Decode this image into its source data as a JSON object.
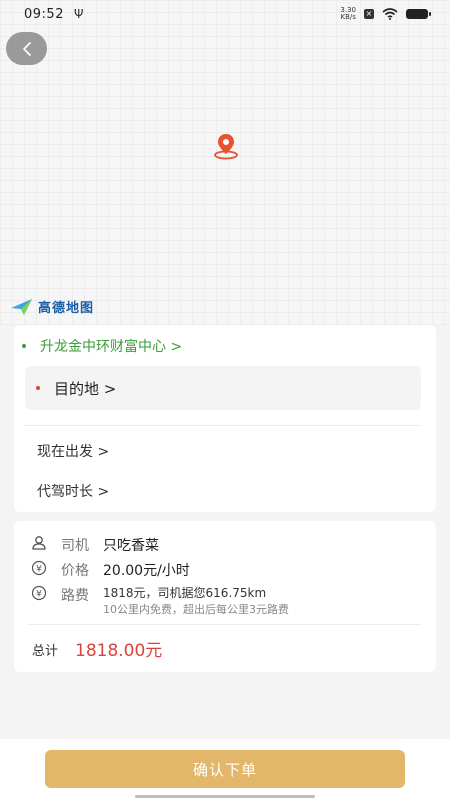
{
  "status_bar": {
    "time": "09:52",
    "net_speed_value": "3.30",
    "net_speed_unit": "KB/s"
  },
  "map": {
    "provider_label": "高德地图",
    "pin_icon": "location-pin-icon",
    "accent_color": "#e8522f"
  },
  "route": {
    "start": "升龙金中环财富中心 >",
    "destination": "目的地 >",
    "depart_time": "现在出发 >",
    "duration": "代驾时长 >"
  },
  "fee": {
    "driver_label": "司机",
    "driver_value": "只吃香菜",
    "price_label": "价格",
    "price_value": "20.00元/小时",
    "road_fee_label": "路费",
    "road_fee_value": "1818元，司机据您616.75km",
    "road_fee_note": "10公里内免费，超出后每公里3元路费",
    "total_label": "总计",
    "total_value": "1818.00元"
  },
  "actions": {
    "confirm_label": "确认下单"
  },
  "colors": {
    "start_green": "#3a9d3a",
    "dest_red": "#d9453a",
    "confirm_bg": "#e2b76a",
    "total_red": "#d9453a"
  }
}
